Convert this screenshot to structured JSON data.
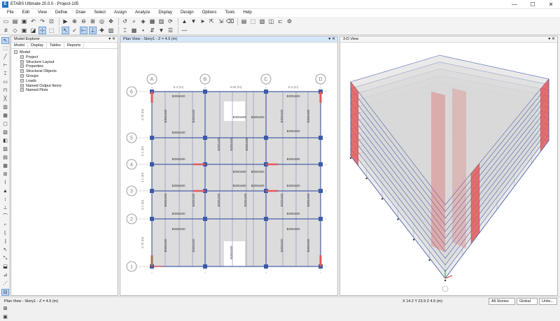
{
  "window": {
    "title": "ETABS Ultimate 20.0.0 - Project-105",
    "app_icon": "E",
    "minimize": "—",
    "maximize": "☐",
    "close": "✕"
  },
  "menu": [
    "File",
    "Edit",
    "View",
    "Define",
    "Draw",
    "Select",
    "Assign",
    "Analyze",
    "Display",
    "Design",
    "Options",
    "Tools",
    "Help"
  ],
  "explorer": {
    "title": "Model Explorer",
    "tabs": [
      "Model",
      "Display",
      "Tables",
      "Reports"
    ],
    "tree": [
      {
        "label": "Model",
        "level": 0,
        "sign": "−"
      },
      {
        "label": "Project",
        "level": 1,
        "sign": "+"
      },
      {
        "label": "Structure Layout",
        "level": 1,
        "sign": "+"
      },
      {
        "label": "Properties",
        "level": 1,
        "sign": "+"
      },
      {
        "label": "Structural Objects",
        "level": 1,
        "sign": "+"
      },
      {
        "label": "Groups",
        "level": 1,
        "sign": "+"
      },
      {
        "label": "Loads",
        "level": 1,
        "sign": "+"
      },
      {
        "label": "Named Output Items",
        "level": 1,
        "sign": "+"
      },
      {
        "label": "Named Plots",
        "level": 1,
        "sign": "+"
      }
    ]
  },
  "plan": {
    "title": "Plan View - Story1 - Z = 4.5 (m)",
    "grid_x": [
      "A",
      "B",
      "C",
      "D"
    ],
    "grid_y": [
      "6",
      "5",
      "4",
      "3",
      "2",
      "1"
    ],
    "span_x": [
      "6.4 (m)",
      "5.60 (m)",
      "6.4 (m)"
    ],
    "span_y": [
      "4.75 (m)",
      "5.1 (m)",
      "4.1 (m)",
      "4.1 (m)",
      "4.75 (m)"
    ],
    "beam_label": "B300x500",
    "beam_label_alt": "B300x400"
  },
  "view3d": {
    "title": "3-D View"
  },
  "status": {
    "left": "Plan View - Story1 - Z = 4.5 (m)",
    "coords": "X 14.2  Y 23.9  Z 4.5 (m)",
    "stories": "All Stories",
    "coord_sys": "Global",
    "units": "Units..."
  },
  "colors": {
    "accent": "#1f6fc9",
    "wall": "#e05a5a",
    "beam": "#4a5fa8",
    "slab": "#dcdcdc",
    "active_tool": "#bcd6f3"
  },
  "icons": {
    "toolbar1": [
      "new-icon",
      "open-icon",
      "save-icon",
      "undo-icon",
      "redo-icon",
      "lock-icon",
      "run-icon",
      "zoom-in-icon",
      "zoom-out-icon",
      "zoom-window-icon",
      "zoom-all-icon",
      "pan-icon",
      "zoom-prev-icon",
      "rubber-zoom-icon",
      "3d-view-icon",
      "plan-view-icon",
      "elevation-view-icon",
      "rotate-icon",
      "up-icon",
      "down-icon",
      "select-icon",
      "deselect-icon",
      "get-previous-icon",
      "clear-icon",
      "display-icon",
      "shrink-icon",
      "object-fill-icon",
      "extrude-icon",
      "ruler-icon",
      "options-icon"
    ],
    "toolbar2": [
      "grid-icon",
      "snap-icon",
      "view-icon",
      "perspective-icon",
      "select-point-icon",
      "select-all-icon",
      "cursor-icon",
      "check-icon",
      "snap-ends-icon",
      "snap-mid-icon",
      "snap-intersect-icon",
      "assign-icon",
      "frame-icon",
      "shell-icon",
      "joint-icon",
      "arrows-icon",
      "filter-icon",
      "display-table-icon",
      "line-style-icon"
    ]
  }
}
